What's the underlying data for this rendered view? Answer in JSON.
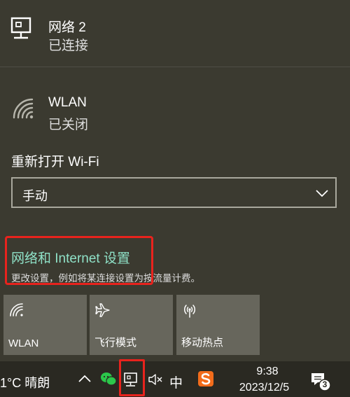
{
  "networks": [
    {
      "name": "网络 2",
      "status": "已连接",
      "icon": "ethernet-icon"
    },
    {
      "name": "WLAN",
      "status": "已关闭",
      "icon": "wifi-icon"
    }
  ],
  "wifi_reenable": {
    "label": "重新打开 Wi-Fi",
    "selected": "手动"
  },
  "settings": {
    "link": "网络和 Internet 设置",
    "description": "更改设置，例如将某连接设置为按流量计费。"
  },
  "quick_actions": [
    {
      "label": "WLAN",
      "icon": "wifi-icon"
    },
    {
      "label": "飞行模式",
      "icon": "airplane-icon"
    },
    {
      "label": "移动热点",
      "icon": "hotspot-icon"
    }
  ],
  "taskbar": {
    "weather": "1°C  晴朗",
    "ime": "中",
    "time": "9:38",
    "date": "2023/12/5",
    "notification_count": "3"
  },
  "colors": {
    "accent_link": "#8fe1c7",
    "highlight": "#e8231d",
    "tile": "#67665c",
    "background": "#3b3a30"
  }
}
